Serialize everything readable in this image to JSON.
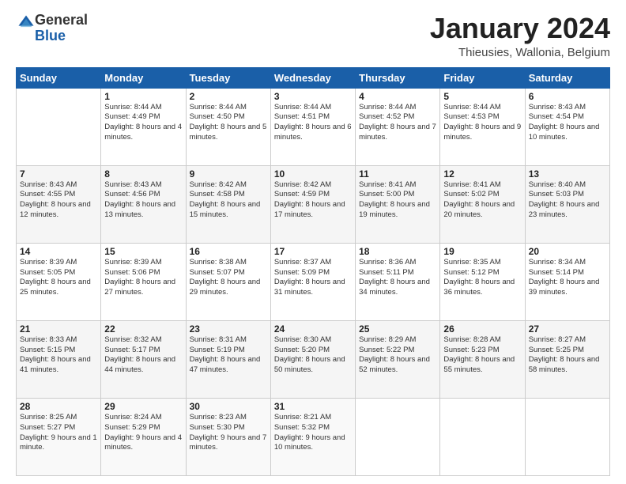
{
  "header": {
    "logo_general": "General",
    "logo_blue": "Blue",
    "month_title": "January 2024",
    "subtitle": "Thieusies, Wallonia, Belgium"
  },
  "weekdays": [
    "Sunday",
    "Monday",
    "Tuesday",
    "Wednesday",
    "Thursday",
    "Friday",
    "Saturday"
  ],
  "weeks": [
    [
      {
        "day": "",
        "sunrise": "",
        "sunset": "",
        "daylight": ""
      },
      {
        "day": "1",
        "sunrise": "Sunrise: 8:44 AM",
        "sunset": "Sunset: 4:49 PM",
        "daylight": "Daylight: 8 hours and 4 minutes."
      },
      {
        "day": "2",
        "sunrise": "Sunrise: 8:44 AM",
        "sunset": "Sunset: 4:50 PM",
        "daylight": "Daylight: 8 hours and 5 minutes."
      },
      {
        "day": "3",
        "sunrise": "Sunrise: 8:44 AM",
        "sunset": "Sunset: 4:51 PM",
        "daylight": "Daylight: 8 hours and 6 minutes."
      },
      {
        "day": "4",
        "sunrise": "Sunrise: 8:44 AM",
        "sunset": "Sunset: 4:52 PM",
        "daylight": "Daylight: 8 hours and 7 minutes."
      },
      {
        "day": "5",
        "sunrise": "Sunrise: 8:44 AM",
        "sunset": "Sunset: 4:53 PM",
        "daylight": "Daylight: 8 hours and 9 minutes."
      },
      {
        "day": "6",
        "sunrise": "Sunrise: 8:43 AM",
        "sunset": "Sunset: 4:54 PM",
        "daylight": "Daylight: 8 hours and 10 minutes."
      }
    ],
    [
      {
        "day": "7",
        "sunrise": "Sunrise: 8:43 AM",
        "sunset": "Sunset: 4:55 PM",
        "daylight": "Daylight: 8 hours and 12 minutes."
      },
      {
        "day": "8",
        "sunrise": "Sunrise: 8:43 AM",
        "sunset": "Sunset: 4:56 PM",
        "daylight": "Daylight: 8 hours and 13 minutes."
      },
      {
        "day": "9",
        "sunrise": "Sunrise: 8:42 AM",
        "sunset": "Sunset: 4:58 PM",
        "daylight": "Daylight: 8 hours and 15 minutes."
      },
      {
        "day": "10",
        "sunrise": "Sunrise: 8:42 AM",
        "sunset": "Sunset: 4:59 PM",
        "daylight": "Daylight: 8 hours and 17 minutes."
      },
      {
        "day": "11",
        "sunrise": "Sunrise: 8:41 AM",
        "sunset": "Sunset: 5:00 PM",
        "daylight": "Daylight: 8 hours and 19 minutes."
      },
      {
        "day": "12",
        "sunrise": "Sunrise: 8:41 AM",
        "sunset": "Sunset: 5:02 PM",
        "daylight": "Daylight: 8 hours and 20 minutes."
      },
      {
        "day": "13",
        "sunrise": "Sunrise: 8:40 AM",
        "sunset": "Sunset: 5:03 PM",
        "daylight": "Daylight: 8 hours and 23 minutes."
      }
    ],
    [
      {
        "day": "14",
        "sunrise": "Sunrise: 8:39 AM",
        "sunset": "Sunset: 5:05 PM",
        "daylight": "Daylight: 8 hours and 25 minutes."
      },
      {
        "day": "15",
        "sunrise": "Sunrise: 8:39 AM",
        "sunset": "Sunset: 5:06 PM",
        "daylight": "Daylight: 8 hours and 27 minutes."
      },
      {
        "day": "16",
        "sunrise": "Sunrise: 8:38 AM",
        "sunset": "Sunset: 5:07 PM",
        "daylight": "Daylight: 8 hours and 29 minutes."
      },
      {
        "day": "17",
        "sunrise": "Sunrise: 8:37 AM",
        "sunset": "Sunset: 5:09 PM",
        "daylight": "Daylight: 8 hours and 31 minutes."
      },
      {
        "day": "18",
        "sunrise": "Sunrise: 8:36 AM",
        "sunset": "Sunset: 5:11 PM",
        "daylight": "Daylight: 8 hours and 34 minutes."
      },
      {
        "day": "19",
        "sunrise": "Sunrise: 8:35 AM",
        "sunset": "Sunset: 5:12 PM",
        "daylight": "Daylight: 8 hours and 36 minutes."
      },
      {
        "day": "20",
        "sunrise": "Sunrise: 8:34 AM",
        "sunset": "Sunset: 5:14 PM",
        "daylight": "Daylight: 8 hours and 39 minutes."
      }
    ],
    [
      {
        "day": "21",
        "sunrise": "Sunrise: 8:33 AM",
        "sunset": "Sunset: 5:15 PM",
        "daylight": "Daylight: 8 hours and 41 minutes."
      },
      {
        "day": "22",
        "sunrise": "Sunrise: 8:32 AM",
        "sunset": "Sunset: 5:17 PM",
        "daylight": "Daylight: 8 hours and 44 minutes."
      },
      {
        "day": "23",
        "sunrise": "Sunrise: 8:31 AM",
        "sunset": "Sunset: 5:19 PM",
        "daylight": "Daylight: 8 hours and 47 minutes."
      },
      {
        "day": "24",
        "sunrise": "Sunrise: 8:30 AM",
        "sunset": "Sunset: 5:20 PM",
        "daylight": "Daylight: 8 hours and 50 minutes."
      },
      {
        "day": "25",
        "sunrise": "Sunrise: 8:29 AM",
        "sunset": "Sunset: 5:22 PM",
        "daylight": "Daylight: 8 hours and 52 minutes."
      },
      {
        "day": "26",
        "sunrise": "Sunrise: 8:28 AM",
        "sunset": "Sunset: 5:23 PM",
        "daylight": "Daylight: 8 hours and 55 minutes."
      },
      {
        "day": "27",
        "sunrise": "Sunrise: 8:27 AM",
        "sunset": "Sunset: 5:25 PM",
        "daylight": "Daylight: 8 hours and 58 minutes."
      }
    ],
    [
      {
        "day": "28",
        "sunrise": "Sunrise: 8:25 AM",
        "sunset": "Sunset: 5:27 PM",
        "daylight": "Daylight: 9 hours and 1 minute."
      },
      {
        "day": "29",
        "sunrise": "Sunrise: 8:24 AM",
        "sunset": "Sunset: 5:29 PM",
        "daylight": "Daylight: 9 hours and 4 minutes."
      },
      {
        "day": "30",
        "sunrise": "Sunrise: 8:23 AM",
        "sunset": "Sunset: 5:30 PM",
        "daylight": "Daylight: 9 hours and 7 minutes."
      },
      {
        "day": "31",
        "sunrise": "Sunrise: 8:21 AM",
        "sunset": "Sunset: 5:32 PM",
        "daylight": "Daylight: 9 hours and 10 minutes."
      },
      {
        "day": "",
        "sunrise": "",
        "sunset": "",
        "daylight": ""
      },
      {
        "day": "",
        "sunrise": "",
        "sunset": "",
        "daylight": ""
      },
      {
        "day": "",
        "sunrise": "",
        "sunset": "",
        "daylight": ""
      }
    ]
  ]
}
